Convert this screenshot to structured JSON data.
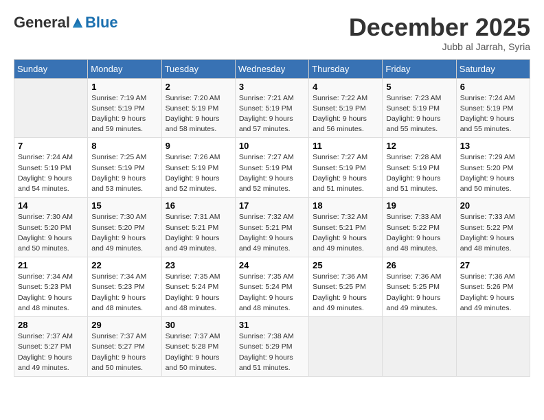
{
  "logo": {
    "part1": "General",
    "part2": "Blue"
  },
  "title": "December 2025",
  "subtitle": "Jubb al Jarrah, Syria",
  "days_header": [
    "Sunday",
    "Monday",
    "Tuesday",
    "Wednesday",
    "Thursday",
    "Friday",
    "Saturday"
  ],
  "weeks": [
    [
      {
        "day": "",
        "detail": ""
      },
      {
        "day": "1",
        "detail": "Sunrise: 7:19 AM\nSunset: 5:19 PM\nDaylight: 9 hours\nand 59 minutes."
      },
      {
        "day": "2",
        "detail": "Sunrise: 7:20 AM\nSunset: 5:19 PM\nDaylight: 9 hours\nand 58 minutes."
      },
      {
        "day": "3",
        "detail": "Sunrise: 7:21 AM\nSunset: 5:19 PM\nDaylight: 9 hours\nand 57 minutes."
      },
      {
        "day": "4",
        "detail": "Sunrise: 7:22 AM\nSunset: 5:19 PM\nDaylight: 9 hours\nand 56 minutes."
      },
      {
        "day": "5",
        "detail": "Sunrise: 7:23 AM\nSunset: 5:19 PM\nDaylight: 9 hours\nand 55 minutes."
      },
      {
        "day": "6",
        "detail": "Sunrise: 7:24 AM\nSunset: 5:19 PM\nDaylight: 9 hours\nand 55 minutes."
      }
    ],
    [
      {
        "day": "7",
        "detail": "Sunrise: 7:24 AM\nSunset: 5:19 PM\nDaylight: 9 hours\nand 54 minutes."
      },
      {
        "day": "8",
        "detail": "Sunrise: 7:25 AM\nSunset: 5:19 PM\nDaylight: 9 hours\nand 53 minutes."
      },
      {
        "day": "9",
        "detail": "Sunrise: 7:26 AM\nSunset: 5:19 PM\nDaylight: 9 hours\nand 52 minutes."
      },
      {
        "day": "10",
        "detail": "Sunrise: 7:27 AM\nSunset: 5:19 PM\nDaylight: 9 hours\nand 52 minutes."
      },
      {
        "day": "11",
        "detail": "Sunrise: 7:27 AM\nSunset: 5:19 PM\nDaylight: 9 hours\nand 51 minutes."
      },
      {
        "day": "12",
        "detail": "Sunrise: 7:28 AM\nSunset: 5:19 PM\nDaylight: 9 hours\nand 51 minutes."
      },
      {
        "day": "13",
        "detail": "Sunrise: 7:29 AM\nSunset: 5:20 PM\nDaylight: 9 hours\nand 50 minutes."
      }
    ],
    [
      {
        "day": "14",
        "detail": "Sunrise: 7:30 AM\nSunset: 5:20 PM\nDaylight: 9 hours\nand 50 minutes."
      },
      {
        "day": "15",
        "detail": "Sunrise: 7:30 AM\nSunset: 5:20 PM\nDaylight: 9 hours\nand 49 minutes."
      },
      {
        "day": "16",
        "detail": "Sunrise: 7:31 AM\nSunset: 5:21 PM\nDaylight: 9 hours\nand 49 minutes."
      },
      {
        "day": "17",
        "detail": "Sunrise: 7:32 AM\nSunset: 5:21 PM\nDaylight: 9 hours\nand 49 minutes."
      },
      {
        "day": "18",
        "detail": "Sunrise: 7:32 AM\nSunset: 5:21 PM\nDaylight: 9 hours\nand 49 minutes."
      },
      {
        "day": "19",
        "detail": "Sunrise: 7:33 AM\nSunset: 5:22 PM\nDaylight: 9 hours\nand 48 minutes."
      },
      {
        "day": "20",
        "detail": "Sunrise: 7:33 AM\nSunset: 5:22 PM\nDaylight: 9 hours\nand 48 minutes."
      }
    ],
    [
      {
        "day": "21",
        "detail": "Sunrise: 7:34 AM\nSunset: 5:23 PM\nDaylight: 9 hours\nand 48 minutes."
      },
      {
        "day": "22",
        "detail": "Sunrise: 7:34 AM\nSunset: 5:23 PM\nDaylight: 9 hours\nand 48 minutes."
      },
      {
        "day": "23",
        "detail": "Sunrise: 7:35 AM\nSunset: 5:24 PM\nDaylight: 9 hours\nand 48 minutes."
      },
      {
        "day": "24",
        "detail": "Sunrise: 7:35 AM\nSunset: 5:24 PM\nDaylight: 9 hours\nand 48 minutes."
      },
      {
        "day": "25",
        "detail": "Sunrise: 7:36 AM\nSunset: 5:25 PM\nDaylight: 9 hours\nand 49 minutes."
      },
      {
        "day": "26",
        "detail": "Sunrise: 7:36 AM\nSunset: 5:25 PM\nDaylight: 9 hours\nand 49 minutes."
      },
      {
        "day": "27",
        "detail": "Sunrise: 7:36 AM\nSunset: 5:26 PM\nDaylight: 9 hours\nand 49 minutes."
      }
    ],
    [
      {
        "day": "28",
        "detail": "Sunrise: 7:37 AM\nSunset: 5:27 PM\nDaylight: 9 hours\nand 49 minutes."
      },
      {
        "day": "29",
        "detail": "Sunrise: 7:37 AM\nSunset: 5:27 PM\nDaylight: 9 hours\nand 50 minutes."
      },
      {
        "day": "30",
        "detail": "Sunrise: 7:37 AM\nSunset: 5:28 PM\nDaylight: 9 hours\nand 50 minutes."
      },
      {
        "day": "31",
        "detail": "Sunrise: 7:38 AM\nSunset: 5:29 PM\nDaylight: 9 hours\nand 51 minutes."
      },
      {
        "day": "",
        "detail": ""
      },
      {
        "day": "",
        "detail": ""
      },
      {
        "day": "",
        "detail": ""
      }
    ]
  ]
}
